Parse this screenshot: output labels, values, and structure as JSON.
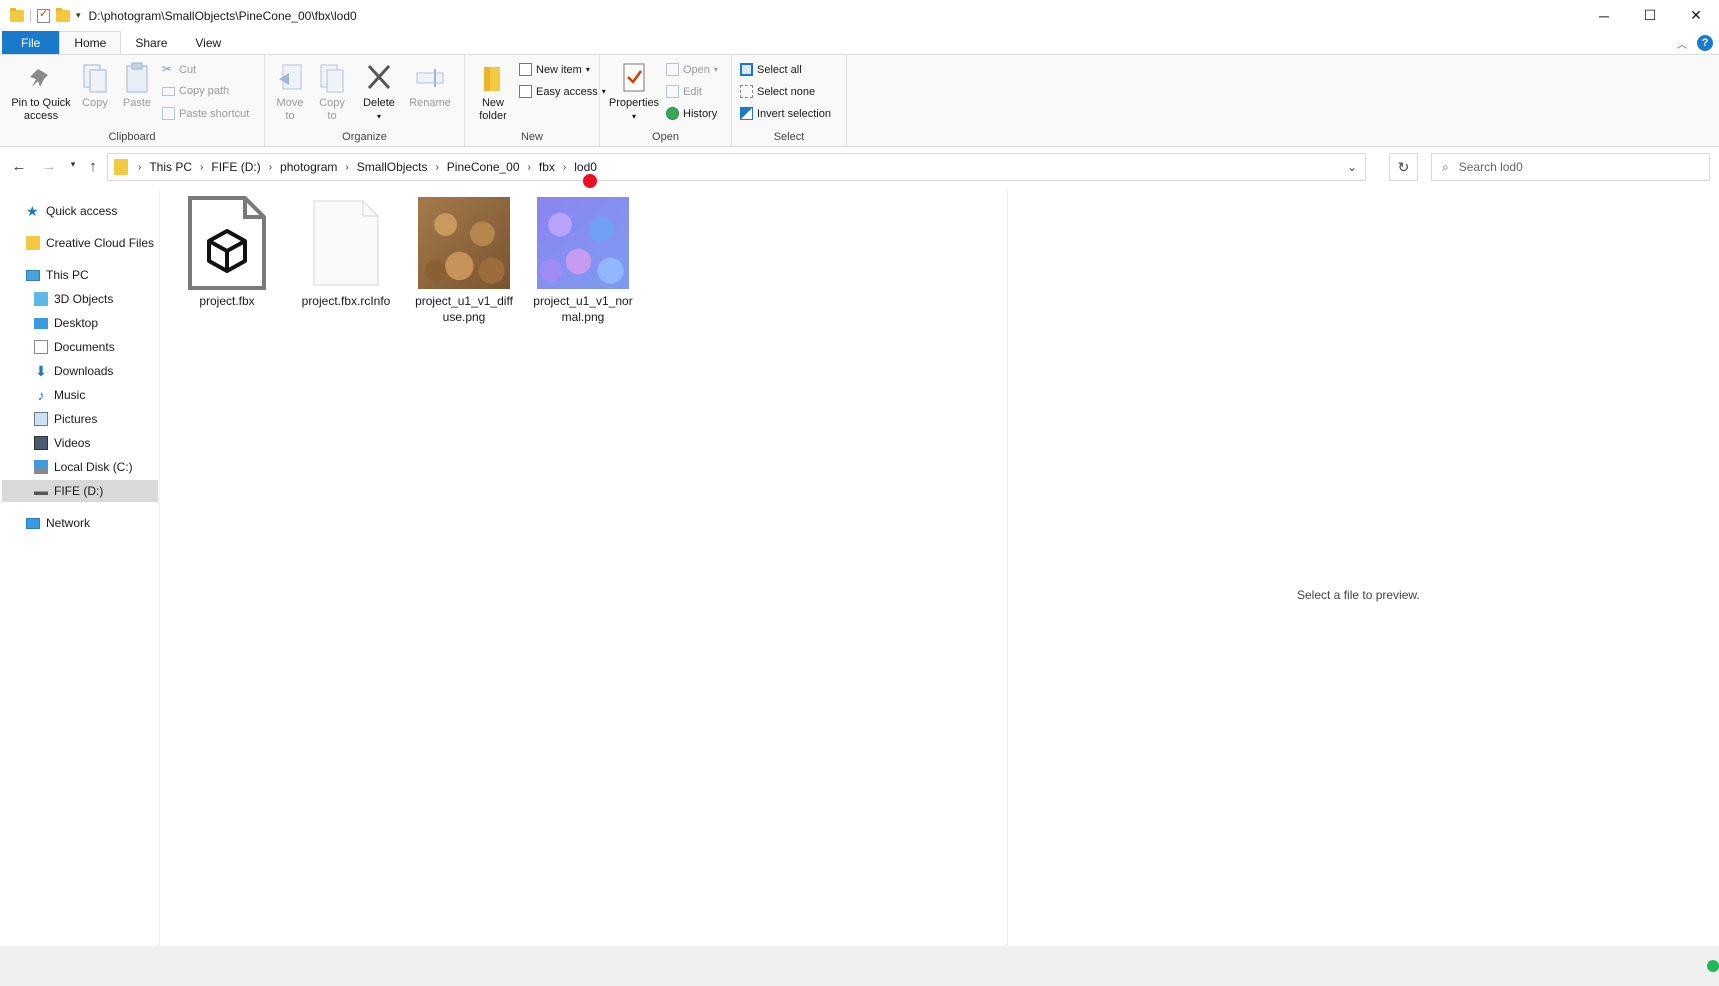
{
  "window": {
    "title_path": "D:\\photogram\\SmallObjects\\PineCone_00\\fbx\\lod0",
    "controls": {
      "minimize": "─",
      "maximize": "☐",
      "close": "✕"
    }
  },
  "ribbon_tabs": [
    "File",
    "Home",
    "Share",
    "View"
  ],
  "ribbon": {
    "clipboard": {
      "label": "Clipboard",
      "pin": "Pin to Quick access",
      "pin_line1": "Pin to Quick",
      "pin_line2": "access",
      "copy": "Copy",
      "paste": "Paste",
      "cut": "Cut",
      "copy_path": "Copy path",
      "paste_shortcut": "Paste shortcut"
    },
    "organize": {
      "label": "Organize",
      "move_to_1": "Move",
      "move_to_2": "to",
      "copy_to_1": "Copy",
      "copy_to_2": "to",
      "delete": "Delete",
      "rename": "Rename"
    },
    "new": {
      "label": "New",
      "new_folder_1": "New",
      "new_folder_2": "folder",
      "new_item": "New item",
      "easy_access": "Easy access"
    },
    "open": {
      "label": "Open",
      "properties": "Properties",
      "open": "Open",
      "edit": "Edit",
      "history": "History"
    },
    "select": {
      "label": "Select",
      "select_all": "Select all",
      "select_none": "Select none",
      "invert": "Invert selection"
    }
  },
  "breadcrumb": [
    "This PC",
    "FIFE (D:)",
    "photogram",
    "SmallObjects",
    "PineCone_00",
    "fbx",
    "lod0"
  ],
  "search": {
    "placeholder": "Search lod0"
  },
  "sidebar": {
    "quick_access": "Quick access",
    "creative_cloud": "Creative Cloud Files",
    "this_pc": "This PC",
    "items": [
      "3D Objects",
      "Desktop",
      "Documents",
      "Downloads",
      "Music",
      "Pictures",
      "Videos",
      "Local Disk (C:)",
      "FIFE (D:)"
    ],
    "network": "Network"
  },
  "files": [
    {
      "name": "project.fbx",
      "icon": "3d-model-file-icon"
    },
    {
      "name": "project.fbx.rcInfo",
      "icon": "blank-file-icon"
    },
    {
      "name": "project_u1_v1_diffuse.png",
      "icon": "image-thumbnail",
      "color": "#a07545"
    },
    {
      "name": "project_u1_v1_normal.png",
      "icon": "image-thumbnail",
      "color": "#8a7df0"
    }
  ],
  "preview": {
    "message": "Select a file to preview."
  }
}
